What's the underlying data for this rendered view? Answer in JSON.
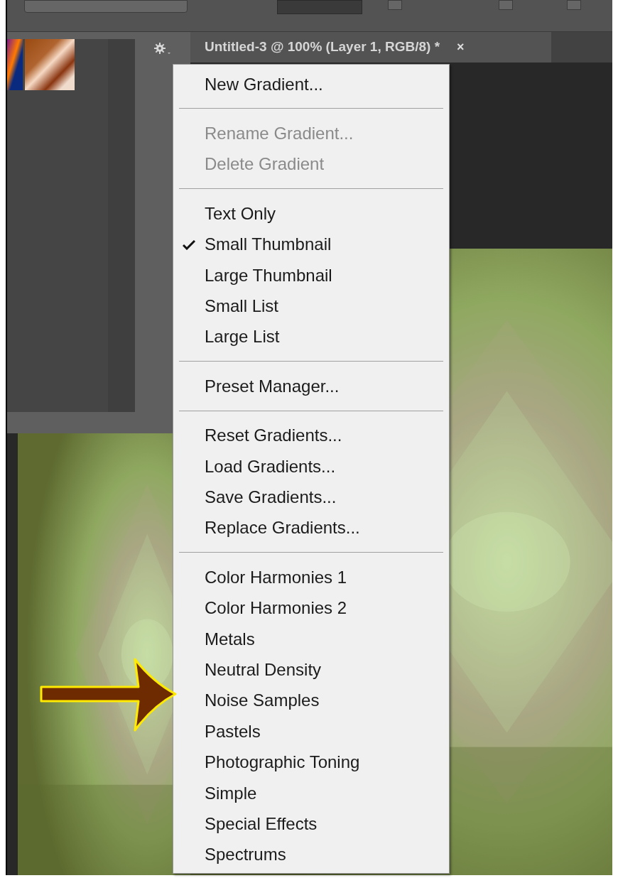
{
  "document_tab": {
    "title": "Untitled-3 @ 100% (Layer 1, RGB/8) *",
    "close": "×",
    "selected": true
  },
  "menu": {
    "items": [
      {
        "kind": "item",
        "label": "New Gradient...",
        "disabled": false,
        "checked": false
      },
      {
        "kind": "separator"
      },
      {
        "kind": "item",
        "label": "Rename Gradient...",
        "disabled": true,
        "checked": false
      },
      {
        "kind": "item",
        "label": "Delete Gradient",
        "disabled": true,
        "checked": false
      },
      {
        "kind": "separator"
      },
      {
        "kind": "item",
        "label": "Text Only",
        "disabled": false,
        "checked": false
      },
      {
        "kind": "item",
        "label": "Small Thumbnail",
        "disabled": false,
        "checked": true
      },
      {
        "kind": "item",
        "label": "Large Thumbnail",
        "disabled": false,
        "checked": false
      },
      {
        "kind": "item",
        "label": "Small List",
        "disabled": false,
        "checked": false
      },
      {
        "kind": "item",
        "label": "Large List",
        "disabled": false,
        "checked": false
      },
      {
        "kind": "separator"
      },
      {
        "kind": "item",
        "label": "Preset Manager...",
        "disabled": false,
        "checked": false
      },
      {
        "kind": "separator"
      },
      {
        "kind": "item",
        "label": "Reset Gradients...",
        "disabled": false,
        "checked": false
      },
      {
        "kind": "item",
        "label": "Load Gradients...",
        "disabled": false,
        "checked": false
      },
      {
        "kind": "item",
        "label": "Save Gradients...",
        "disabled": false,
        "checked": false
      },
      {
        "kind": "item",
        "label": "Replace Gradients...",
        "disabled": false,
        "checked": false
      },
      {
        "kind": "separator"
      },
      {
        "kind": "item",
        "label": "Color Harmonies 1",
        "disabled": false,
        "checked": false
      },
      {
        "kind": "item",
        "label": "Color Harmonies 2",
        "disabled": false,
        "checked": false
      },
      {
        "kind": "item",
        "label": "Metals",
        "disabled": false,
        "checked": false
      },
      {
        "kind": "item",
        "label": "Neutral Density",
        "disabled": false,
        "checked": false
      },
      {
        "kind": "item",
        "label": "Noise Samples",
        "disabled": false,
        "checked": false
      },
      {
        "kind": "item",
        "label": "Pastels",
        "disabled": false,
        "checked": false
      },
      {
        "kind": "item",
        "label": "Photographic Toning",
        "disabled": false,
        "checked": false
      },
      {
        "kind": "item",
        "label": "Simple",
        "disabled": false,
        "checked": false
      },
      {
        "kind": "item",
        "label": "Special Effects",
        "disabled": false,
        "checked": false
      },
      {
        "kind": "item",
        "label": "Spectrums",
        "disabled": false,
        "checked": false
      }
    ]
  }
}
